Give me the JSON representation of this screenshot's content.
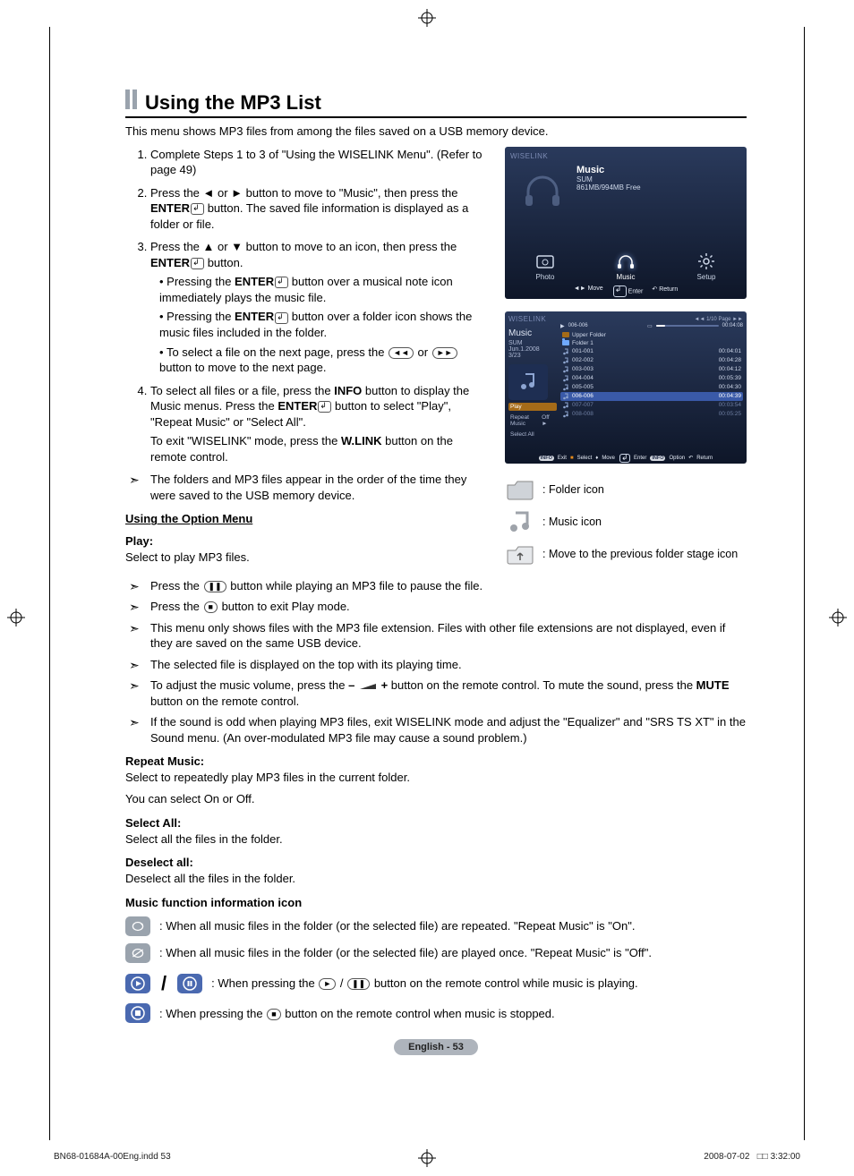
{
  "page": {
    "title": "Using the MP3 List",
    "intro": "This menu shows MP3 files from among the files saved on a USB memory device.",
    "footer_label": "English - 53",
    "indd": "BN68-01684A-00Eng.indd   53",
    "print_date": "2008-07-02",
    "print_time": "□□ 3:32:00"
  },
  "steps": {
    "s1": "Complete Steps 1 to 3 of \"Using the WISELINK Menu\". (Refer to page 49)",
    "s2_a": "Press the ◄ or ► button to move to \"Music\", then press the ",
    "s2_enter": "ENTER",
    "s2_b": " button. The saved file information is displayed as a folder or file.",
    "s3_a": "Press the ▲ or ▼ button to move to an icon, then press the ",
    "s3_b": " button.",
    "s3_b1_a": "Pressing the ",
    "s3_b1_b": " button over a musical note icon immediately plays the music file.",
    "s3_b2_a": "Pressing the ",
    "s3_b2_b": " button over a folder icon shows the music files included in the folder.",
    "s3_b3_a": "To select a file on the next page, press the ",
    "s3_b3_mid": " or ",
    "s3_b3_b": " button to move to the next page.",
    "s4_a": "To select all files or a file, press the ",
    "s4_info": "INFO",
    "s4_b": " button to display the Music menus. Press the ",
    "s4_c": " button to select \"Play\", \"Repeat Music\" or \"Select All\".",
    "s4_exit_a": "To exit \"WISELINK\" mode, press the ",
    "s4_exit_wlink": "W.LINK",
    "s4_exit_b": " button on the remote control.",
    "note_order": "The folders and MP3 files appear in the order of the time they were saved to the USB memory device."
  },
  "option": {
    "heading": "Using the Option Menu",
    "play_label": "Play:",
    "play_desc": "Select to play MP3 files.",
    "n1_a": "Press the ",
    "n1_b": " button while playing an MP3 file to pause the file.",
    "n2_a": "Press the ",
    "n2_b": " button to exit Play mode.",
    "n3": "This menu only shows files with the MP3 file extension. Files with other file extensions are not displayed, even if they are saved on the same USB device.",
    "n4": "The selected file is displayed on the top with its playing time.",
    "n5_a": "To adjust the music volume, press the ",
    "n5_minus": "–",
    "n5_plus": "+",
    "n5_b": " button on the remote control. To mute the sound, press the ",
    "n5_mute": "MUTE",
    "n5_c": " button on the remote control.",
    "n6": "If the sound is odd when playing MP3 files, exit WISELINK mode and adjust the \"Equalizer\" and \"SRS TS XT\" in the Sound menu. (An over-modulated MP3 file may cause a sound problem.)",
    "repeat_label": "Repeat Music:",
    "repeat_desc1": "Select to repeatedly play MP3 files in the current folder.",
    "repeat_desc2": "You can select On or Off.",
    "selectall_label": "Select All:",
    "selectall_desc": "Select all the files in the folder.",
    "deselect_label": "Deselect all:",
    "deselect_desc": "Deselect all the files in the folder.",
    "func_heading": "Music function information icon",
    "func1": ": When all music files in the folder (or the selected file) are repeated. \"Repeat Music\" is \"On\".",
    "func2": ": When all music files in the folder (or the selected file) are played once. \"Repeat Music\" is \"Off\".",
    "func3_a": ": When pressing the ",
    "func3_mid": " / ",
    "func3_b": " button on the remote control while music is playing.",
    "func4_a": ": When pressing the ",
    "func4_b": " button on the remote control when music is stopped."
  },
  "screen1": {
    "brand": "WISELINK",
    "music_label": "Music",
    "sum": "SUM",
    "free": "861MB/994MB Free",
    "tabs": {
      "photo": "Photo",
      "music": "Music",
      "setup": "Setup"
    },
    "hints": {
      "move": "Move",
      "enter": "Enter",
      "return": "Return"
    }
  },
  "screen2": {
    "brand": "WISELINK",
    "label": "Music",
    "storage": "SUM",
    "date": "Jun.1.2008",
    "count": "3/23",
    "options": {
      "play": "Play",
      "repeat": "Repeat Music",
      "repeat_val": "Off ►",
      "selectall": "Select All"
    },
    "page_info": "1/10 Page",
    "current_track": "006-006",
    "now_dur": "00:04:08",
    "rows": [
      {
        "icon": "up",
        "name": "Upper Folder",
        "dur": ""
      },
      {
        "icon": "folder",
        "name": "Folder 1",
        "dur": ""
      },
      {
        "icon": "note",
        "name": "001-001",
        "dur": "00:04:01"
      },
      {
        "icon": "note",
        "name": "002-002",
        "dur": "00:04:28"
      },
      {
        "icon": "note",
        "name": "003-003",
        "dur": "00:04:12"
      },
      {
        "icon": "note",
        "name": "004-004",
        "dur": "00:05:39"
      },
      {
        "icon": "note",
        "name": "005-005",
        "dur": "00:04:30"
      },
      {
        "icon": "note",
        "name": "006-006",
        "dur": "00:04:39",
        "sel": true
      },
      {
        "icon": "note",
        "name": "007-007",
        "dur": "00:03:54",
        "dim": true
      },
      {
        "icon": "note",
        "name": "008-008",
        "dur": "00:05:25",
        "dim": true
      }
    ],
    "hints": {
      "exit": "Exit",
      "select": "Select",
      "move": "Move",
      "enter": "Enter",
      "option": "Option",
      "return": "Return",
      "info": "INFO"
    }
  },
  "legend": {
    "folder": ": Folder icon",
    "music": ": Music icon",
    "up": ": Move to the previous folder stage icon"
  }
}
